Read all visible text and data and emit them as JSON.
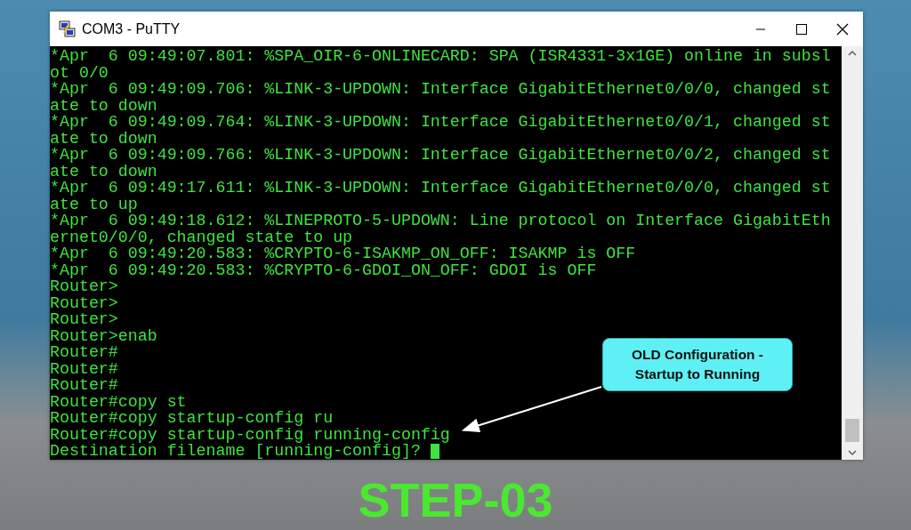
{
  "window": {
    "title": "COM3 - PuTTY"
  },
  "terminal": {
    "lines": [
      "*Apr  6 09:49:07.801: %SPA_OIR-6-ONLINECARD: SPA (ISR4331-3x1GE) online in subsl",
      "ot 0/0",
      "*Apr  6 09:49:09.706: %LINK-3-UPDOWN: Interface GigabitEthernet0/0/0, changed st",
      "ate to down",
      "*Apr  6 09:49:09.764: %LINK-3-UPDOWN: Interface GigabitEthernet0/0/1, changed st",
      "ate to down",
      "*Apr  6 09:49:09.766: %LINK-3-UPDOWN: Interface GigabitEthernet0/0/2, changed st",
      "ate to down",
      "*Apr  6 09:49:17.611: %LINK-3-UPDOWN: Interface GigabitEthernet0/0/0, changed st",
      "ate to up",
      "*Apr  6 09:49:18.612: %LINEPROTO-5-UPDOWN: Line protocol on Interface GigabitEth",
      "ernet0/0/0, changed state to up",
      "*Apr  6 09:49:20.583: %CRYPTO-6-ISAKMP_ON_OFF: ISAKMP is OFF",
      "*Apr  6 09:49:20.583: %CRYPTO-6-GDOI_ON_OFF: GDOI is OFF",
      "Router>",
      "Router>",
      "Router>",
      "Router>enab",
      "Router#",
      "Router#",
      "Router#",
      "Router#copy st",
      "Router#copy startup-config ru",
      "Router#copy startup-config running-config",
      "Destination filename [running-config]? "
    ],
    "cursor": true
  },
  "callout": {
    "lines": [
      "OLD Configuration -",
      "Startup to Running"
    ]
  },
  "step_label": "STEP-03"
}
